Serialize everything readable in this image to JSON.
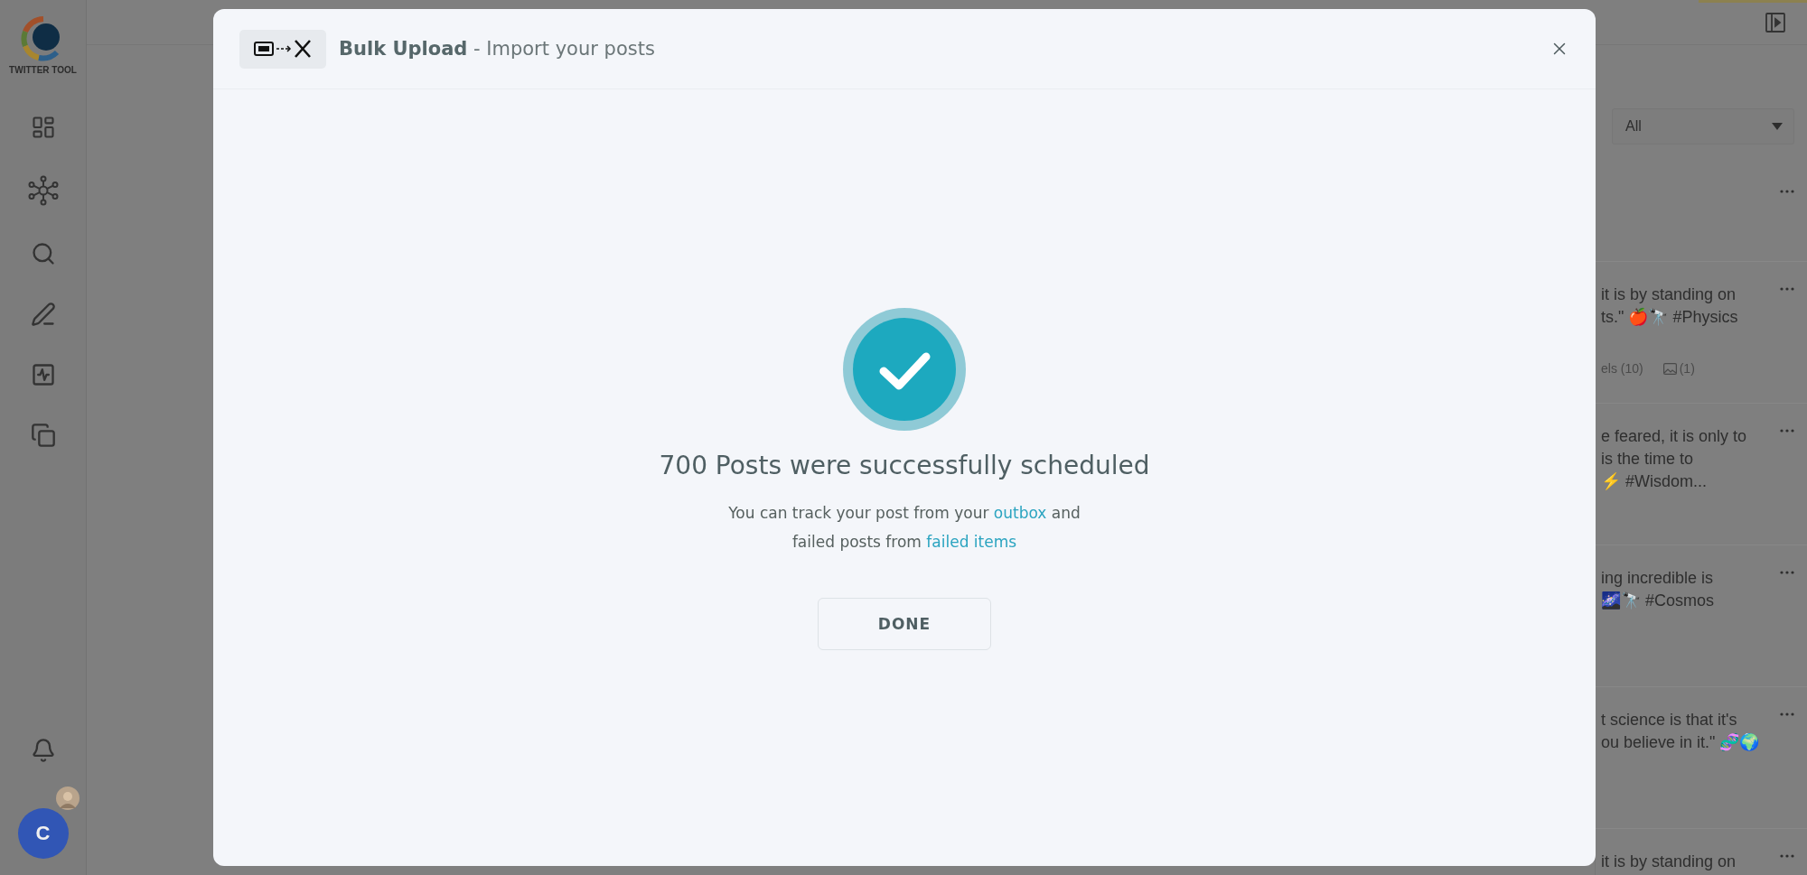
{
  "sidebar": {
    "brand": "TWITTER TOOL",
    "avatar_initial": "C"
  },
  "filter": {
    "value": "All"
  },
  "posts": [
    {
      "lines": [
        "it is by standing on",
        "ts.\" 🍎🔭 #Physics"
      ],
      "meta": {
        "labels": "els (10)",
        "images": "(1)"
      }
    },
    {
      "lines": [
        "e feared, it is only to",
        "is the time to",
        "⚡ #Wisdom..."
      ]
    },
    {
      "lines": [
        "ing incredible is",
        "🌌🔭 #Cosmos"
      ]
    },
    {
      "lines": [
        "t science is that it's",
        "ou believe in it.\" 🧬🌍"
      ]
    },
    {
      "lines": [
        "it is by standing on"
      ]
    }
  ],
  "dialog": {
    "title": "**Bulk Upload** - Import your posts",
    "heading": "700 Posts were successfully scheduled",
    "message_lines": [
      [
        {
          "kind": "text",
          "text": "You can track your post from your "
        },
        {
          "kind": "link",
          "text": "outbox"
        },
        {
          "kind": "text",
          "text": " and"
        }
      ],
      [
        {
          "kind": "text",
          "text": "failed posts from "
        },
        {
          "kind": "link",
          "text": "failed items"
        }
      ]
    ],
    "button": "DONE"
  }
}
